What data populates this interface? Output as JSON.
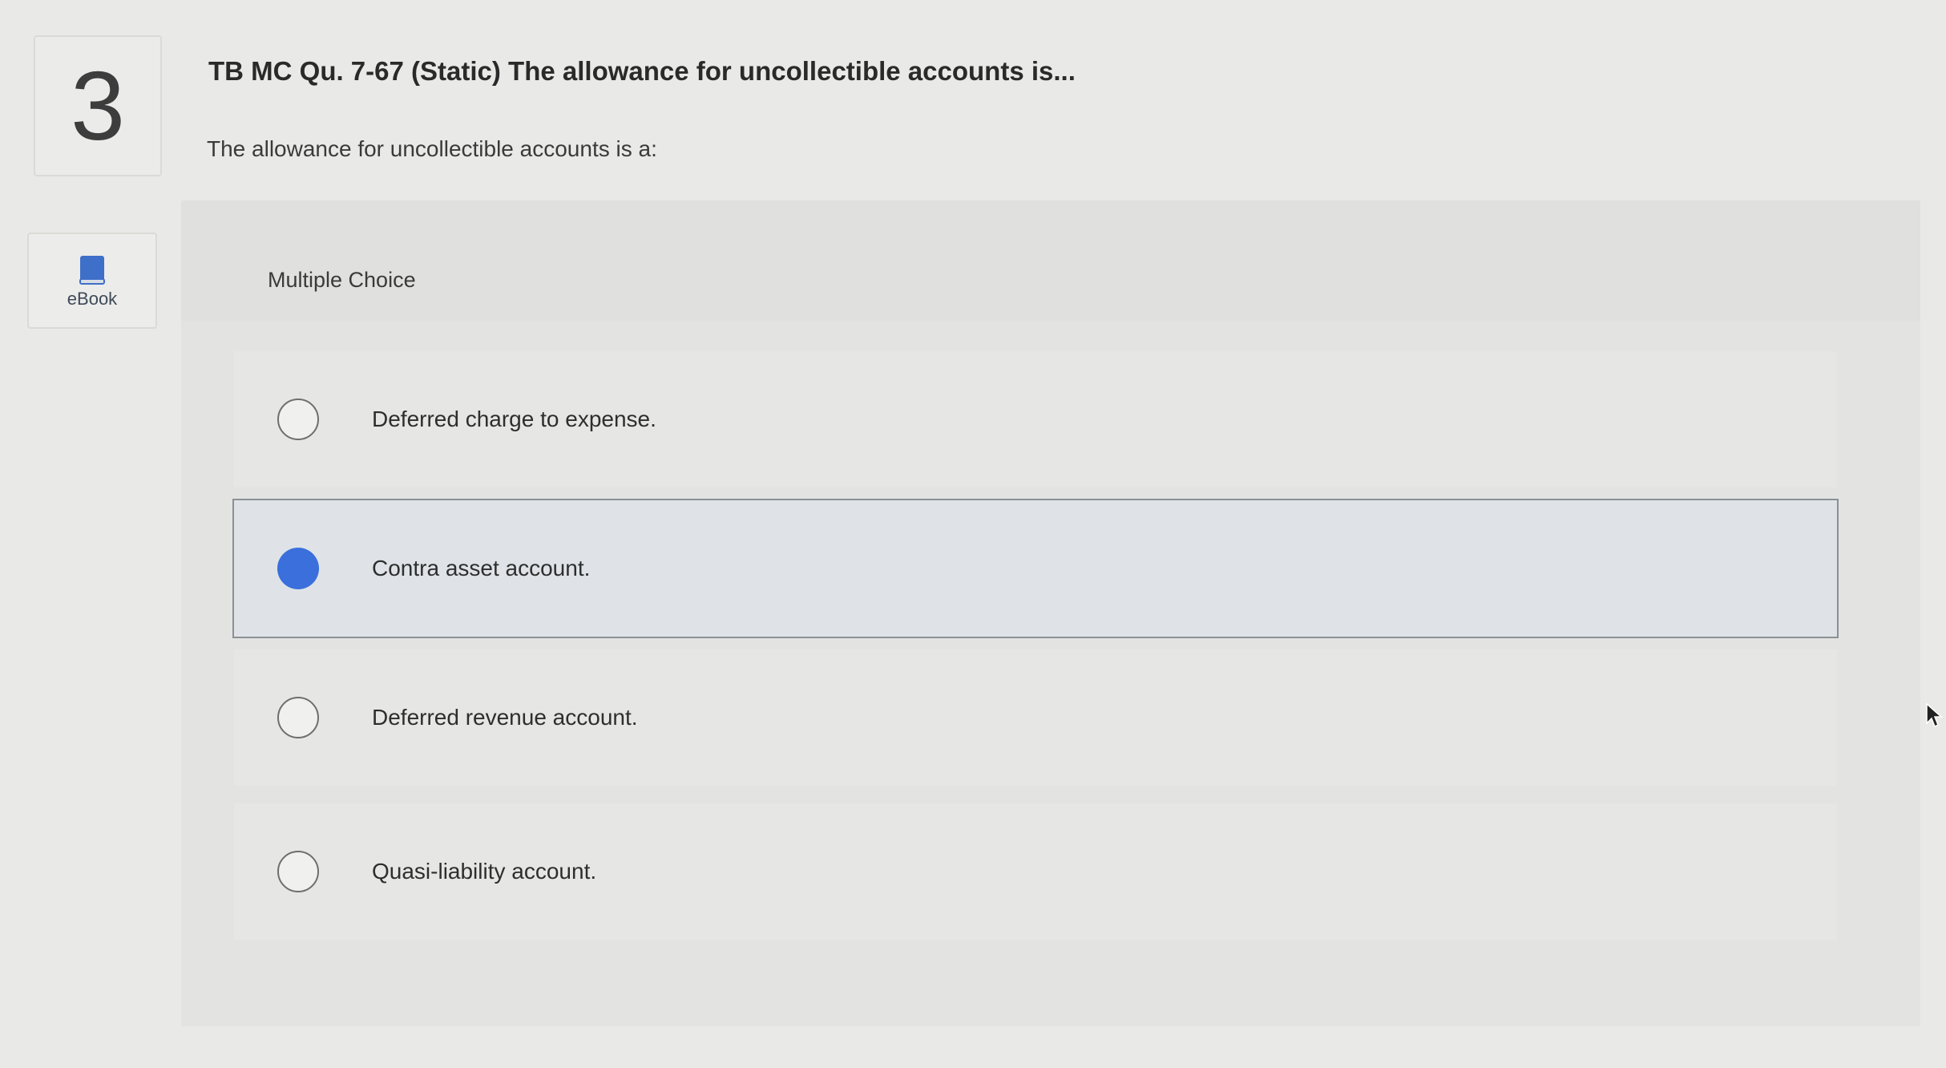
{
  "question": {
    "number": "3",
    "title": "TB MC Qu. 7-67 (Static) The allowance for uncollectible accounts is...",
    "prompt": "The allowance for uncollectible accounts is a:"
  },
  "ebook": {
    "label": "eBook",
    "icon": "book-icon"
  },
  "multiple_choice": {
    "label": "Multiple Choice",
    "options": [
      {
        "text": "Deferred charge to expense.",
        "selected": false
      },
      {
        "text": "Contra asset account.",
        "selected": true
      },
      {
        "text": "Deferred revenue account.",
        "selected": false
      },
      {
        "text": "Quasi-liability account.",
        "selected": false
      }
    ]
  },
  "colors": {
    "selected_radio": "#3a6fdc",
    "selected_row": "#dfe3e7"
  }
}
